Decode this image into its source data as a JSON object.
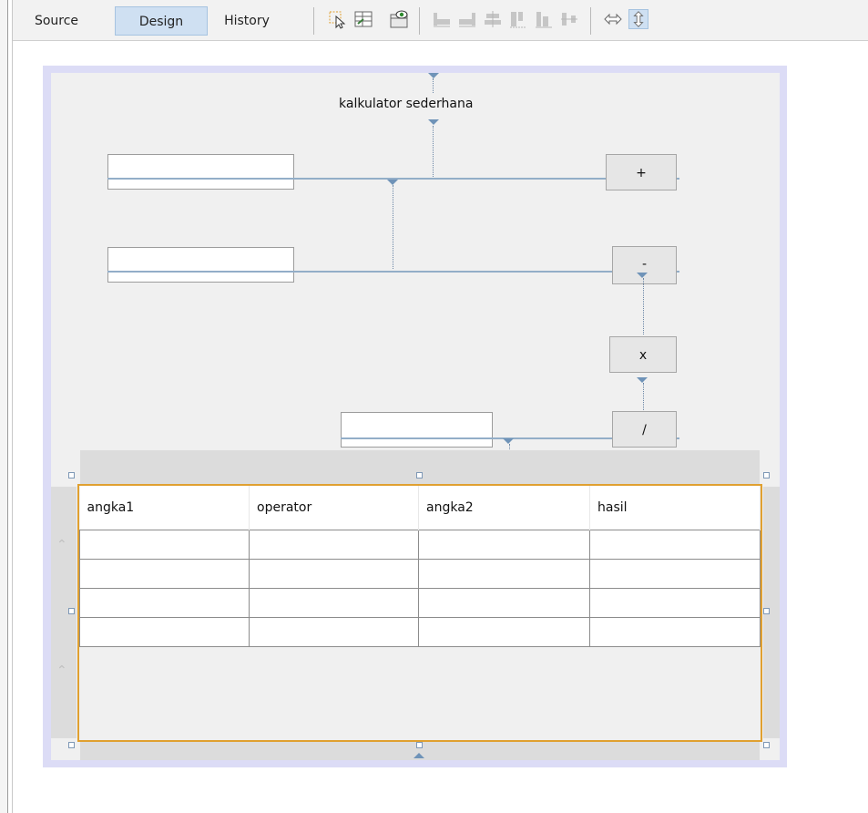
{
  "toolbar": {
    "tabs": [
      {
        "label": "Source",
        "active": false
      },
      {
        "label": "Design",
        "active": true
      },
      {
        "label": "History",
        "active": false
      }
    ],
    "icons": [
      "selection-mode-icon",
      "connection-mode-icon",
      "preview-design-icon",
      "align-left-icon",
      "align-right-icon",
      "center-horizontally-icon",
      "align-top-icon",
      "align-bottom-icon",
      "center-vertically-icon",
      "resize-horizontal-icon",
      "resize-vertical-icon"
    ]
  },
  "form": {
    "title": "kalkulator sederhana",
    "inputs": [
      {
        "name": "input-angka1",
        "value": ""
      },
      {
        "name": "input-angka2",
        "value": ""
      },
      {
        "name": "input-hasil",
        "value": ""
      }
    ],
    "buttons": {
      "add": "+",
      "subtract": "-",
      "multiply": "x",
      "divide": "/"
    }
  },
  "table": {
    "columns": [
      "angka1",
      "operator",
      "angka2",
      "hasil"
    ],
    "rows": [
      [
        "",
        "",
        "",
        ""
      ],
      [
        "",
        "",
        "",
        ""
      ],
      [
        "",
        "",
        "",
        ""
      ],
      [
        "",
        "",
        "",
        ""
      ]
    ]
  },
  "colors": {
    "selection_border": "#e0a030",
    "guide_line": "#93aec8",
    "active_tab": "#cfe0f2"
  }
}
